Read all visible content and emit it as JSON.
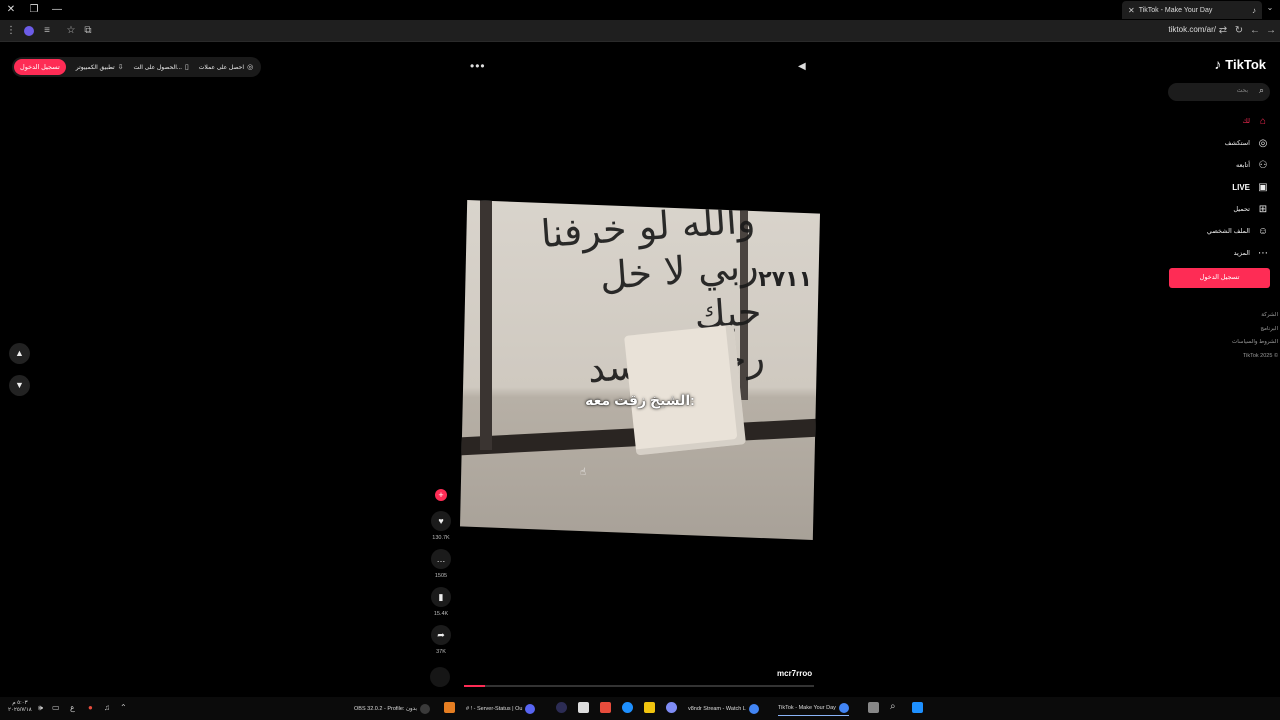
{
  "browser": {
    "tab_title": "TikTok - Make Your Day",
    "url": "tiktok.com/ar/",
    "new_tab_symbol": "+",
    "menu_symbol": "⌄"
  },
  "top_pill": {
    "login": "تسجيل الدخول",
    "desktop_app": "تطبيق الكمبيوتر",
    "get_app": "الحصول على الت...",
    "get_coins": "احصل على عملات"
  },
  "sidebar": {
    "logo": "TikTok",
    "search_placeholder": "بحث",
    "items": [
      {
        "label": "لك",
        "icon": "home-icon"
      },
      {
        "label": "استكشف",
        "icon": "compass-icon"
      },
      {
        "label": "أتابعه",
        "icon": "following-icon"
      },
      {
        "label": "LIVE",
        "icon": "live-icon"
      },
      {
        "label": "تحميل",
        "icon": "upload-icon"
      },
      {
        "label": "الملف الشخصي",
        "icon": "profile-icon"
      },
      {
        "label": "المزيد",
        "icon": "more-icon"
      }
    ],
    "login_button": "تسجيل الدخول",
    "footer": [
      "الشركة",
      "البرنامج",
      "الشروط والسياسات",
      "TikTok 2025 ©"
    ]
  },
  "video": {
    "caption": "الشيخ زقت معه:",
    "author": "mcr7rroo",
    "progress": 0.06
  },
  "actions": {
    "likes": "130.7K",
    "comments": "1505",
    "saves": "15.4K",
    "shares": "37K"
  },
  "taskbar": {
    "time": "٥:٠٣ م",
    "date": "٢٠٢٥/٧/١٨",
    "tasks": [
      "OBS 32.0.2 - Profile: بدون",
      "# ! - Server-Status | Ou",
      "v8ndr Stream - Watch L",
      "TikTok - Make Your Day"
    ]
  },
  "colors": {
    "accent": "#fe2c55",
    "background": "#000000"
  }
}
